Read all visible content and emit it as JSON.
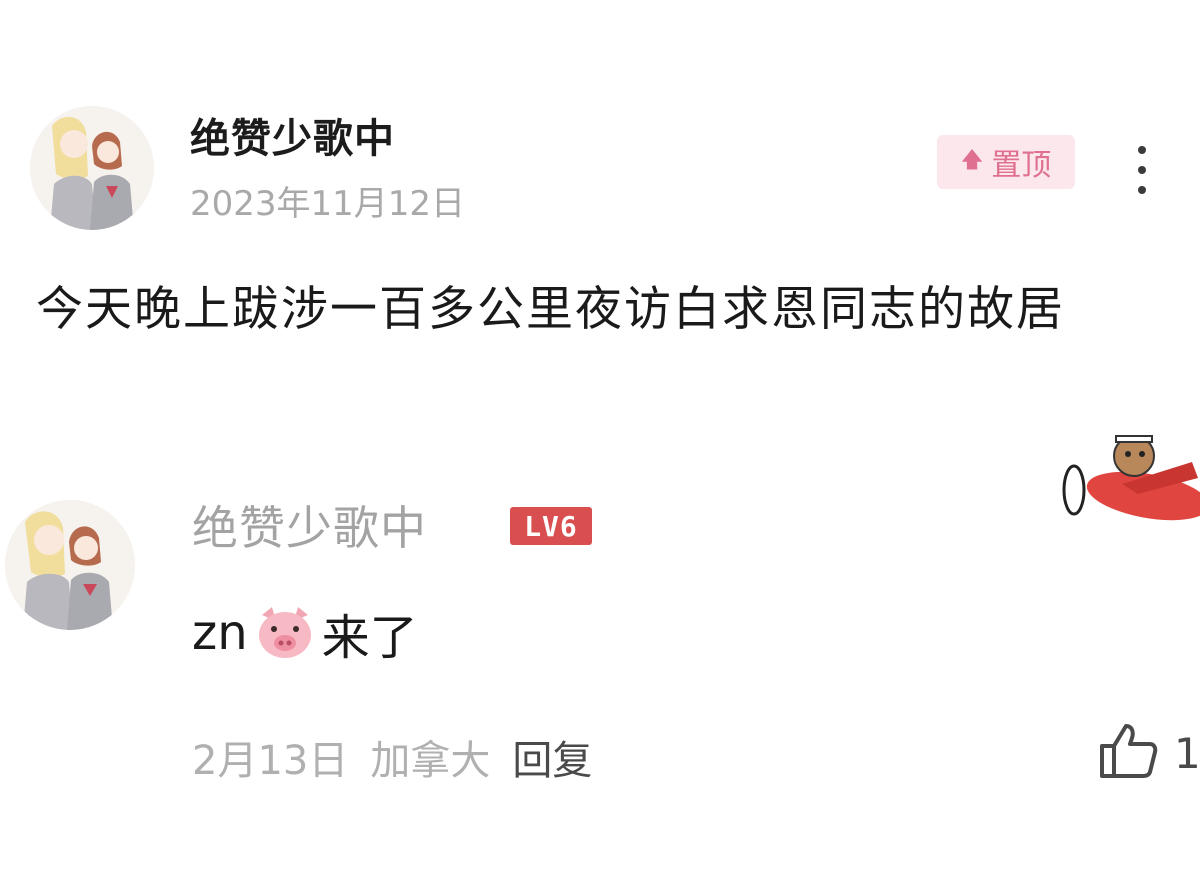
{
  "post": {
    "username": "绝赞少歌中",
    "date": "2023年11月12日",
    "pin_label": "置顶",
    "content": "今天晚上跋涉一百多公里夜访白求恩同志的故居"
  },
  "comment": {
    "username": "绝赞少歌中",
    "level": "LV6",
    "text_before": "zn",
    "emoji": "pig-face",
    "text_after": "来了",
    "date": "2月13日",
    "location": "加拿大",
    "reply_label": "回复",
    "like_count": "1"
  },
  "colors": {
    "pin_badge_bg": "#fbe7ec",
    "pin_badge_text": "#e0708f",
    "level_badge_bg": "#d94f4f",
    "muted_text": "#a9a9a9"
  },
  "icons": [
    "pin-arrow-icon",
    "more-vertical-icon",
    "pig-emoji-icon",
    "thumbs-up-icon",
    "plane-sticker"
  ]
}
